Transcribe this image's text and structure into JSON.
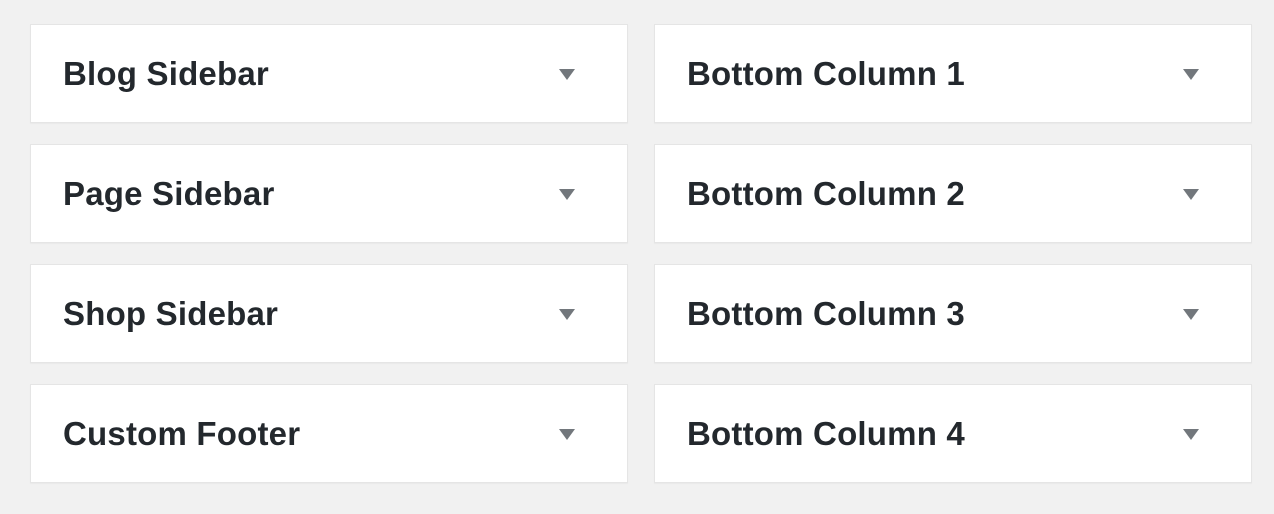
{
  "widget_areas": {
    "left": [
      {
        "title": "Blog Sidebar",
        "toggle_icon": "triangle-down-icon"
      },
      {
        "title": "Page Sidebar",
        "toggle_icon": "triangle-down-icon"
      },
      {
        "title": "Shop Sidebar",
        "toggle_icon": "triangle-down-icon"
      },
      {
        "title": "Custom Footer",
        "toggle_icon": "triangle-down-icon"
      }
    ],
    "right": [
      {
        "title": "Bottom Column 1",
        "toggle_icon": "triangle-down-icon"
      },
      {
        "title": "Bottom Column 2",
        "toggle_icon": "triangle-down-icon"
      },
      {
        "title": "Bottom Column 3",
        "toggle_icon": "triangle-down-icon"
      },
      {
        "title": "Bottom Column 4",
        "toggle_icon": "triangle-down-icon"
      }
    ]
  },
  "colors": {
    "background": "#f1f1f1",
    "panel": "#ffffff",
    "text": "#23282d",
    "arrow": "#72777c"
  }
}
